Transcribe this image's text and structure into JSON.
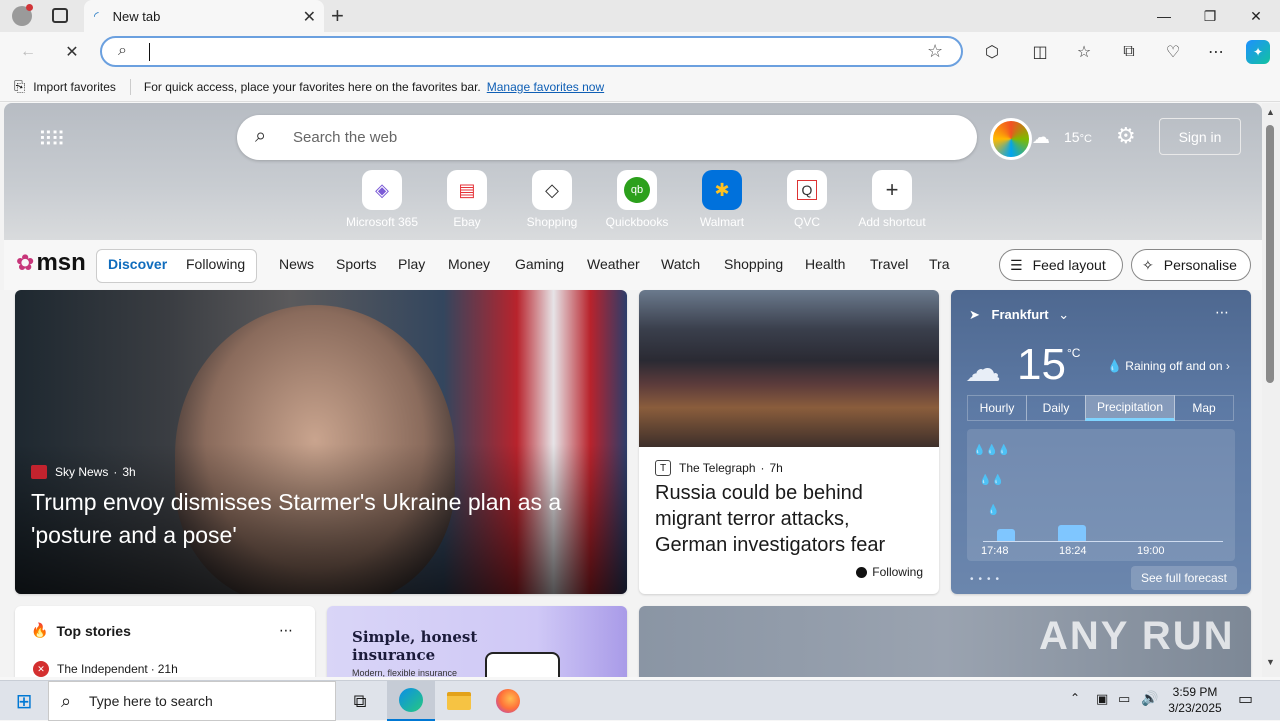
{
  "browser": {
    "tab_title": "New tab",
    "address_value": "",
    "favbar_import": "Import favorites",
    "favbar_text": "For quick access, place your favorites here on the favorites bar.",
    "favbar_link": "Manage favorites now"
  },
  "hero": {
    "search_placeholder": "Search the web",
    "temperature": "15",
    "temp_unit": "°C",
    "signin": "Sign in",
    "shortcuts": [
      {
        "label": "Microsoft 365",
        "icon": "microsoft-365-icon"
      },
      {
        "label": "Ebay",
        "icon": "ebay-icon"
      },
      {
        "label": "Shopping",
        "icon": "shopping-tag-icon"
      },
      {
        "label": "Quickbooks",
        "icon": "quickbooks-icon"
      },
      {
        "label": "Walmart",
        "icon": "walmart-icon"
      },
      {
        "label": "QVC",
        "icon": "qvc-icon"
      },
      {
        "label": "Add shortcut",
        "icon": "plus-icon"
      }
    ]
  },
  "nav": {
    "brand": "msn",
    "tabs": [
      "Discover",
      "Following"
    ],
    "categories": [
      "News",
      "Sports",
      "Play",
      "Money",
      "Gaming",
      "Weather",
      "Watch",
      "Shopping",
      "Health",
      "Travel",
      "Tra"
    ],
    "feed_layout": "Feed layout",
    "personalise": "Personalise"
  },
  "feed": {
    "main": {
      "source": "Sky News",
      "age": "3h",
      "headline": "Trump envoy dismisses Starmer's Ukraine plan as a 'posture and a pose'"
    },
    "second": {
      "source": "The Telegraph",
      "age": "7h",
      "headline": "Russia could be behind migrant terror attacks, German investigators fear",
      "follow": "Following"
    },
    "weather": {
      "location": "Frankfurt",
      "temperature": "15",
      "unit": "°C",
      "condition": "Raining off and on",
      "tabs": [
        "Hourly",
        "Daily",
        "Precipitation",
        "Map"
      ],
      "active_tab": "Precipitation",
      "times": [
        "17:48",
        "18:24",
        "19:00"
      ],
      "full_forecast": "See full forecast"
    },
    "top_stories": {
      "title": "Top stories",
      "source": "The Independent",
      "age": "21h"
    },
    "promo": {
      "title": "Simple, honest insurance",
      "subtitle": "Modern, flexible insurance"
    },
    "watermark": "ANY RUN"
  },
  "taskbar": {
    "search_placeholder": "Type here to search",
    "time": "3:59 PM",
    "date": "3/23/2025"
  },
  "colors": {
    "accent": "#0f6cbd",
    "address_border": "#6ba0df",
    "weather_bg": "#5d7aa5"
  }
}
